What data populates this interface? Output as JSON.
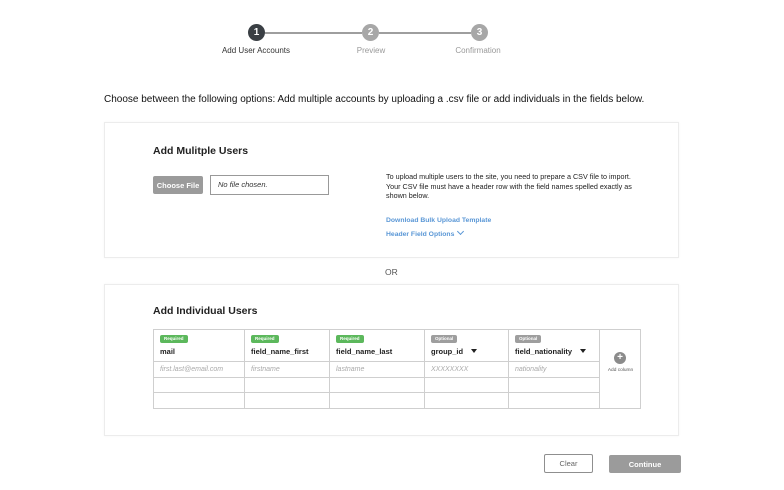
{
  "stepper": {
    "steps": [
      {
        "number": "1",
        "label": "Add User Accounts",
        "state": "active"
      },
      {
        "number": "2",
        "label": "Preview",
        "state": "inactive"
      },
      {
        "number": "3",
        "label": "Confirmation",
        "state": "inactive"
      }
    ]
  },
  "intro": "Choose between the following options: Add multiple accounts by uploading a .csv file or add individuals in the fields below.",
  "multiple": {
    "title": "Add Mulitple Users",
    "choose_file_label": "Choose File",
    "file_status": "No file chosen.",
    "info": "To upload multiple users to the site, you need to prepare a CSV file to import. Your CSV file must have a header row with the field names spelled exactly as shown below.",
    "download_link": "Download Bulk Upload Template",
    "header_options_link": "Header Field Options"
  },
  "or_label": "OR",
  "individual": {
    "title": "Add Individual Users",
    "columns": [
      {
        "badge": "Required",
        "name": "mail",
        "placeholder": "first.last@email.com",
        "dropdown": false
      },
      {
        "badge": "Required",
        "name": "field_name_first",
        "placeholder": "firstname",
        "dropdown": false
      },
      {
        "badge": "Required",
        "name": "field_name_last",
        "placeholder": "lastname",
        "dropdown": false
      },
      {
        "badge": "Optional",
        "name": "group_id",
        "placeholder": "XXXXXXXX",
        "dropdown": true
      },
      {
        "badge": "Optional",
        "name": "field_nationality",
        "placeholder": "nationality",
        "dropdown": true
      }
    ],
    "add_column_label": "Add column"
  },
  "actions": {
    "clear": "Clear",
    "continue": "Continue"
  },
  "colors": {
    "active_step": "#3a3f44",
    "inactive_step": "#a7a7a7",
    "required_badge": "#5cb85c",
    "optional_badge": "#9e9e9e",
    "link": "#5a97d6",
    "button_gray": "#9b9b9b"
  },
  "icons": {
    "add_column": "plus-circle-icon",
    "header_options": "chevron-down-icon",
    "column_dropdown": "caret-down-icon"
  }
}
